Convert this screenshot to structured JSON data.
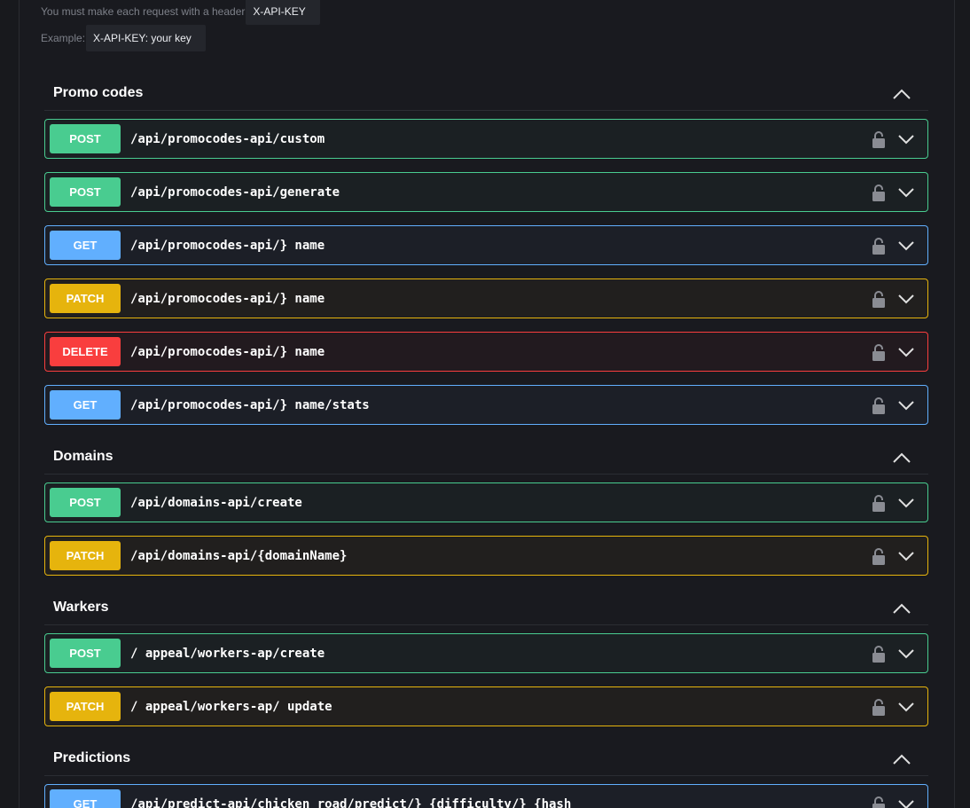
{
  "auth_info": {
    "line1_text": "You must make each request with a header",
    "line1_code": "X-API-KEY",
    "line2_text": "Example:",
    "line2_code": "X-API-KEY: your key"
  },
  "colors": {
    "post": "#49cc90",
    "get": "#61affe",
    "patch": "#e6b40d",
    "delete": "#f93e3e"
  },
  "sections": [
    {
      "title": "Promo codes",
      "operations": [
        {
          "method": "POST",
          "path": "/api/promocodes-api/custom"
        },
        {
          "method": "POST",
          "path": "/api/promocodes-api/generate"
        },
        {
          "method": "GET",
          "path": "/api/promocodes-api/} name"
        },
        {
          "method": "PATCH",
          "path": "/api/promocodes-api/} name"
        },
        {
          "method": "DELETE",
          "path": "/api/promocodes-api/} name"
        },
        {
          "method": "GET",
          "path": "/api/promocodes-api/} name/stats"
        }
      ]
    },
    {
      "title": "Domains",
      "operations": [
        {
          "method": "POST",
          "path": "/api/domains-api/create"
        },
        {
          "method": "PATCH",
          "path": "/api/domains-api/{domainName}"
        }
      ]
    },
    {
      "title": "Warkers",
      "operations": [
        {
          "method": "POST",
          "path": "/ appeal/workers-ap/create"
        },
        {
          "method": "PATCH",
          "path": "/ appeal/workers-ap/ update"
        }
      ]
    },
    {
      "title": "Predictions",
      "operations": [
        {
          "method": "GET",
          "path": "/api/predict-api/chicken_road/predict/} {difficulty/} {hash"
        }
      ]
    }
  ]
}
